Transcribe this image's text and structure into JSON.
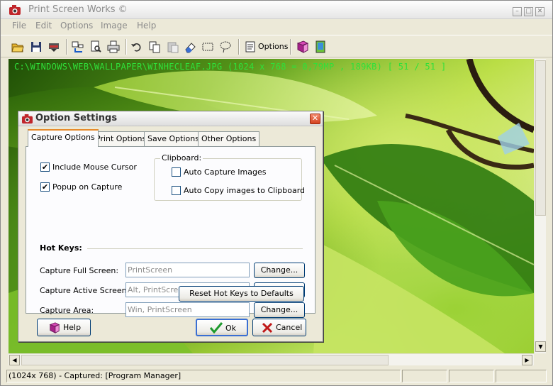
{
  "window": {
    "title": "Print Screen Works ©",
    "controls": [
      "minimize",
      "maximize",
      "close"
    ]
  },
  "menu": [
    "File",
    "Edit",
    "Options",
    "Image",
    "Help"
  ],
  "toolbar": {
    "icons": [
      "open-folder-icon",
      "save-icon",
      "save-as-icon",
      "capture-icon",
      "print-preview-icon",
      "print-icon",
      "undo-icon",
      "copy-icon",
      "paste-icon",
      "eraser-icon",
      "select-rectangle-icon",
      "lasso-icon",
      "options-icon",
      "book-icon",
      "wallpaper-icon"
    ],
    "options_label": "Options"
  },
  "image": {
    "info": "C:\\WINDOWS\\WEB\\WALLPAPER\\WINHECLEAF.JPG  (1024 x 768 = 0,79MP  ,  189KB) [ 51 / 51 ]"
  },
  "status": {
    "text": "(1024x 768) - Captured: [Program Manager]"
  },
  "dialog": {
    "title": "Option Settings",
    "tabs": [
      "Capture Options",
      "Print Options",
      "Save Options",
      "Other Options"
    ],
    "active_tab": "Capture Options",
    "include_mouse_cursor": {
      "label": "Include Mouse Cursor",
      "checked": true
    },
    "popup_on_capture": {
      "label": "Popup on Capture",
      "checked": true
    },
    "clipboard": {
      "legend": "Clipboard:",
      "auto_capture": {
        "label": "Auto Capture Images",
        "checked": false
      },
      "auto_copy": {
        "label": "Auto Copy images to Clipboard",
        "checked": false
      }
    },
    "hotkeys": {
      "title": "Hot Keys:",
      "rows": [
        {
          "label": "Capture Full Screen:",
          "value": "PrintScreen",
          "button": "Change..."
        },
        {
          "label": "Capture Active Screen:",
          "value": "Alt, PrintScreen",
          "button": "Change..."
        },
        {
          "label": "Capture Area:",
          "value": "Win, PrintScreen",
          "button": "Change..."
        }
      ],
      "reset_button": "Reset Hot Keys to Defaults"
    },
    "buttons": {
      "help": "Help",
      "ok": "Ok",
      "cancel": "Cancel"
    }
  },
  "colors": {
    "image_info_text": "#2fe03a",
    "window_face": "#ece9d8",
    "tab_highlight": "#e68b2c",
    "default_button_border": "#3a6fd3"
  }
}
